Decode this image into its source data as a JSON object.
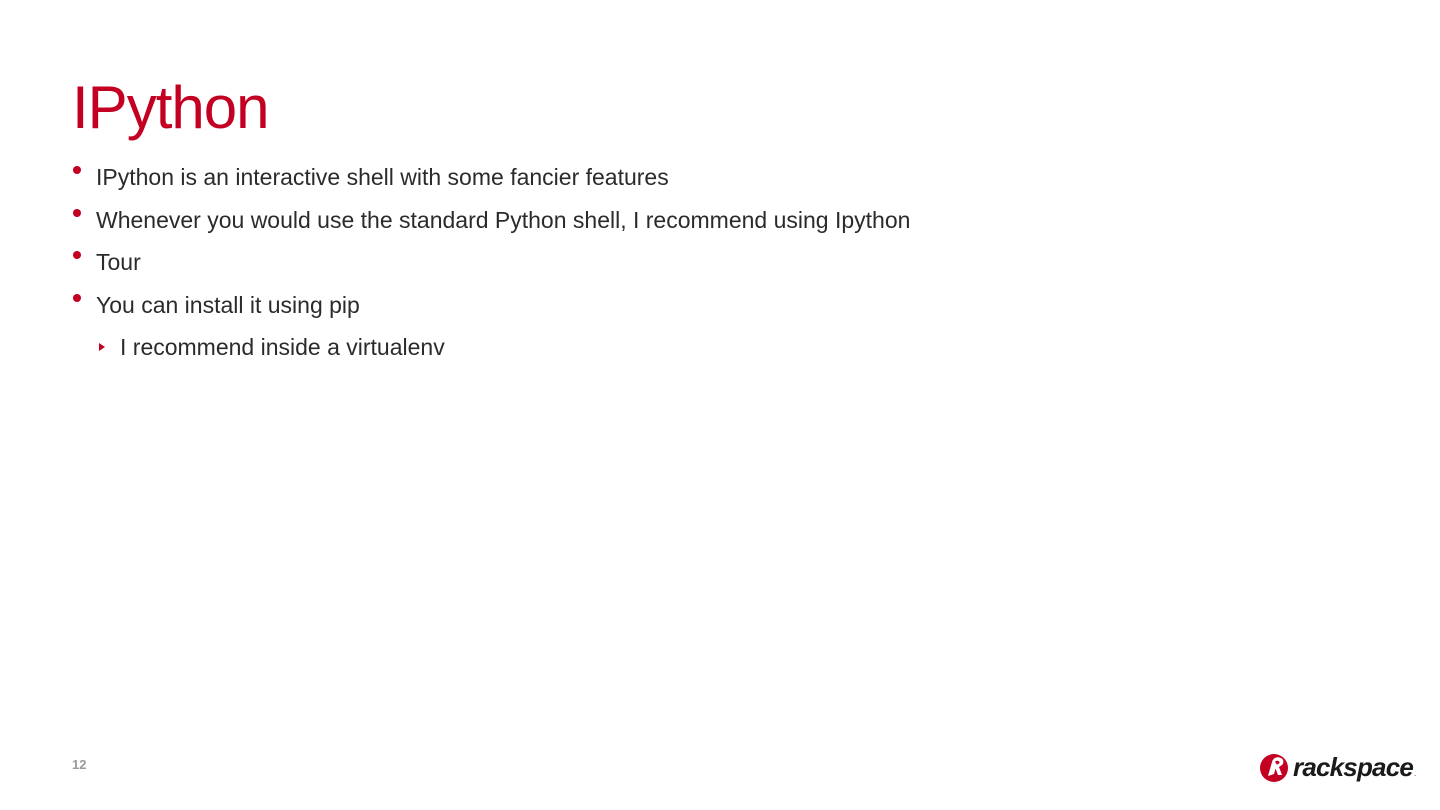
{
  "slide": {
    "title": "IPython",
    "page_number": "12",
    "accent_color": "#c40022"
  },
  "bullets": [
    {
      "text": "IPython is an interactive shell with some fancier features",
      "level": 1
    },
    {
      "text": "Whenever you would use the standard Python shell, I recommend using Ipython",
      "level": 1
    },
    {
      "text": "Tour",
      "level": 1
    },
    {
      "text": "You can install it using pip",
      "level": 1
    },
    {
      "text": "I recommend inside a virtualenv",
      "level": 2
    }
  ],
  "logo": {
    "text": "rackspace",
    "registered_mark": ".",
    "icon": "rackspace-logo-icon"
  }
}
